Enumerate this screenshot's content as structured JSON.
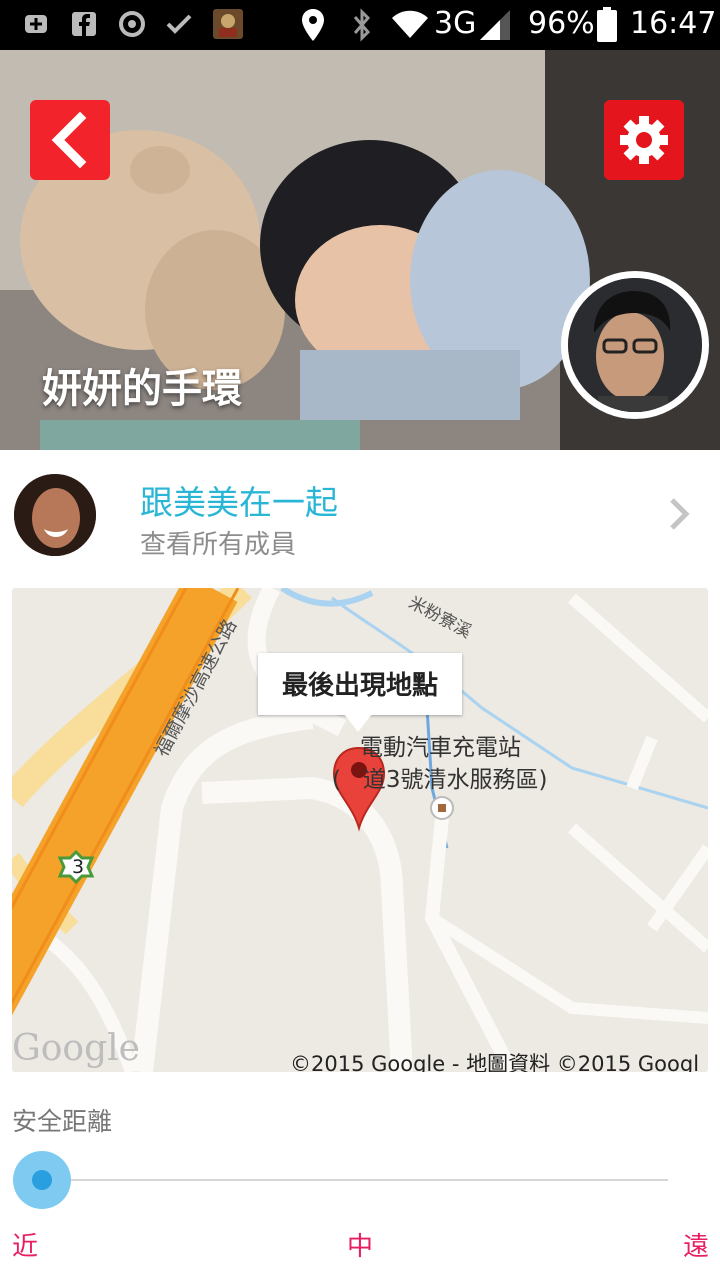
{
  "status_bar": {
    "network": "3G",
    "battery": "96%",
    "time": "16:47"
  },
  "header": {
    "title": "妍妍的手環"
  },
  "member": {
    "title": "跟美美在一起",
    "subtitle": "查看所有成員"
  },
  "map": {
    "callout": "最後出現地點",
    "poi_line1": "電動汽車充電站",
    "poi_line2": "(國道3號清水服務區)",
    "poi_line2_visible": "(   道3號清水服務區)",
    "road_highway": "福爾摩沙高速公路",
    "road_stream": "米粉寮溪",
    "highway_shield": "3",
    "logo": "Google",
    "copyright": "©2015 Google - 地圖資料 ©2015 Googl"
  },
  "safe_distance": {
    "label": "安全距離",
    "near": "近",
    "mid": "中",
    "far": "遠",
    "value": 0
  },
  "colors": {
    "accent": "#29b6d6",
    "red_button": "#f2232b",
    "tick_color": "#e81e63"
  }
}
